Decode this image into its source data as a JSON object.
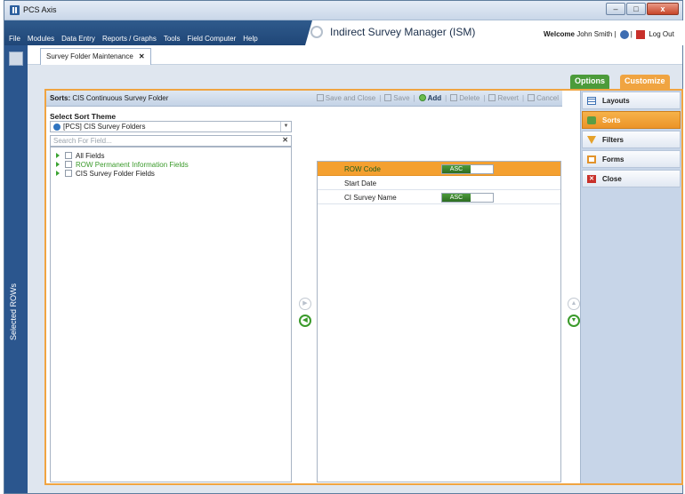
{
  "app": {
    "title": "PCS Axis",
    "window_buttons": [
      "–",
      "□",
      "x"
    ]
  },
  "menu": {
    "items": [
      "File",
      "Modules",
      "Data Entry",
      "Reports / Graphs",
      "Tools",
      "Field Computer",
      "Help"
    ]
  },
  "module": {
    "title": "Indirect Survey Manager (ISM)"
  },
  "user": {
    "welcome": "Welcome",
    "name": "John Smith",
    "logout": "Log Out"
  },
  "sidebar": {
    "label": "Selected ROWs"
  },
  "tab": {
    "label": "Survey Folder Maintenance",
    "close": "✕"
  },
  "panel_tabs": {
    "options": "Options",
    "customize": "Customize"
  },
  "header": {
    "prefix": "Sorts:",
    "title": "CIS Continuous Survey Folder"
  },
  "toolbar": {
    "save_close": "Save and Close",
    "save": "Save",
    "add": "Add",
    "delete": "Delete",
    "revert": "Revert",
    "cancel": "Cancel"
  },
  "theme": {
    "label": "Select Sort Theme",
    "selected": "[PCS] CIS Survey Folders"
  },
  "search": {
    "placeholder": "Search For Field..."
  },
  "tree": [
    {
      "label": "All Fields",
      "green": false
    },
    {
      "label": "ROW Permanent Information Fields",
      "green": true
    },
    {
      "label": "CIS Survey Folder Fields",
      "green": false
    }
  ],
  "sorts": [
    {
      "label": "ROW Code",
      "order": "ASC",
      "selected": true
    },
    {
      "label": "Start Date",
      "order": "",
      "selected": false
    },
    {
      "label": "CI Survey Name",
      "order": "ASC",
      "selected": false
    }
  ],
  "nav": [
    {
      "label": "Layouts",
      "icon": "layouts-icon"
    },
    {
      "label": "Sorts",
      "icon": "sorts-icon"
    },
    {
      "label": "Filters",
      "icon": "filters-icon"
    },
    {
      "label": "Forms",
      "icon": "forms-icon"
    },
    {
      "label": "Close",
      "icon": "close-icon"
    }
  ],
  "colors": {
    "accent": "#f0a441",
    "nav_bar": "#2b568e",
    "green": "#3a9a2a"
  }
}
